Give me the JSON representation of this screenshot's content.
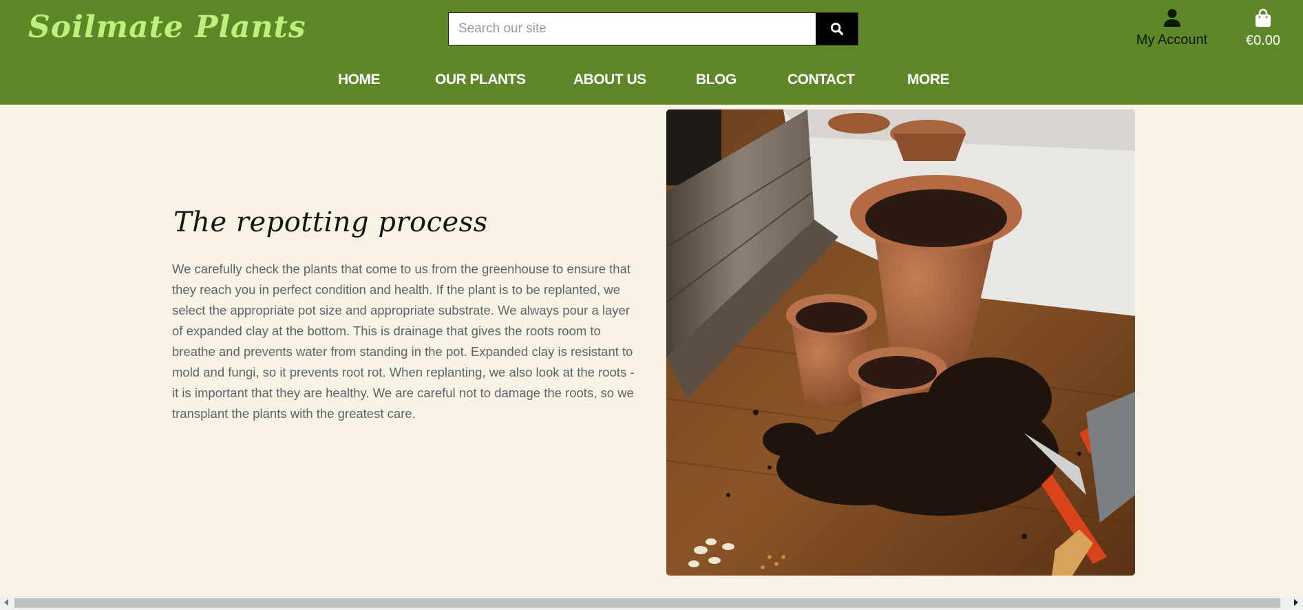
{
  "header": {
    "logo": "Soilmate Plants",
    "search": {
      "placeholder": "Search our site"
    },
    "account_label": "My Account",
    "cart_total": "€0.00",
    "icons": {
      "search": "search-icon",
      "account": "user-icon",
      "cart": "shopping-bag-icon"
    }
  },
  "nav": {
    "items": [
      {
        "label": "HOME"
      },
      {
        "label": "OUR PLANTS"
      },
      {
        "label": "ABOUT US"
      },
      {
        "label": "BLOG"
      },
      {
        "label": "CONTACT"
      },
      {
        "label": "MORE"
      }
    ]
  },
  "main": {
    "heading": "The repotting process",
    "paragraph": "We carefully check the plants that come to us from the greenhouse to ensure that they reach you in perfect condition and health. If the plant is to be replanted, we select the appropriate pot size and appropriate substrate. We always pour a layer of expanded clay at the bottom. This is drainage that gives the roots room to breathe and prevents water from standing in the pot. Expanded clay is resistant to mold and fungi, so it prevents root rot. When replanting, we also look at the roots - it is important that they are healthy. We are careful not to damage the roots, so we transplant the plants with the greatest care."
  },
  "colors": {
    "header_bg": "#5e8727",
    "logo": "#bff07e",
    "page_bg": "#f9f3e6",
    "body_text": "#5b646b"
  }
}
